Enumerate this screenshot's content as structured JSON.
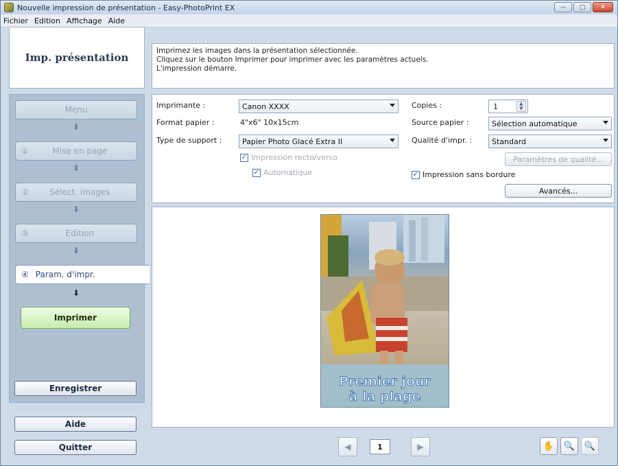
{
  "window": {
    "title": "Nouvelle impression de présentation - Easy-PhotoPrint EX",
    "controls": [
      "—",
      "□",
      "✕"
    ]
  },
  "menubar": [
    "Fichier",
    "Edition",
    "Affichage",
    "Aide"
  ],
  "sidebar": {
    "header": "Imp. présentation",
    "steps": [
      {
        "num": "",
        "label": "Menu"
      },
      {
        "num": "①",
        "label": "Mise en page"
      },
      {
        "num": "②",
        "label": "Sélect. images"
      },
      {
        "num": "③",
        "label": "Edition"
      },
      {
        "num": "④",
        "label": "Param. d'impr."
      }
    ],
    "print_button": "Imprimer",
    "save_button": "Enregistrer",
    "help_button": "Aide",
    "quit_button": "Quitter"
  },
  "info": {
    "lines": [
      "Imprimez les images dans la présentation sélectionnée.",
      "Cliquez sur le bouton Imprimer pour imprimer avec les paramètres actuels.",
      "L'impression démarre."
    ]
  },
  "settings": {
    "printer_label": "Imprimante :",
    "printer_value": "Canon XXXX",
    "paper_size_label": "Format papier :",
    "paper_size_value": "4\"x6\" 10x15cm",
    "media_type_label": "Type de support :",
    "media_type_value": "Papier Photo Glacé Extra II",
    "duplex_label": "Impression recto/verso",
    "auto_label": "Automatique",
    "copies_label": "Copies :",
    "copies_value": "1",
    "paper_source_label": "Source papier :",
    "paper_source_value": "Sélection automatique",
    "quality_label": "Qualité d'impr. :",
    "quality_value": "Standard",
    "quality_settings_button": "Paramètres de qualité...",
    "borderless_label": "Impression sans bordure",
    "advanced_button": "Avancés..."
  },
  "preview": {
    "caption_line1": "Premier jour",
    "caption_line2": "à la plage"
  },
  "pager": {
    "page": "1",
    "prev_icon": "◀",
    "next_icon": "▶"
  },
  "tools": {
    "hand_icon": "✋",
    "zoom_in_icon": "🔍",
    "zoom_out_icon": "🔍"
  }
}
